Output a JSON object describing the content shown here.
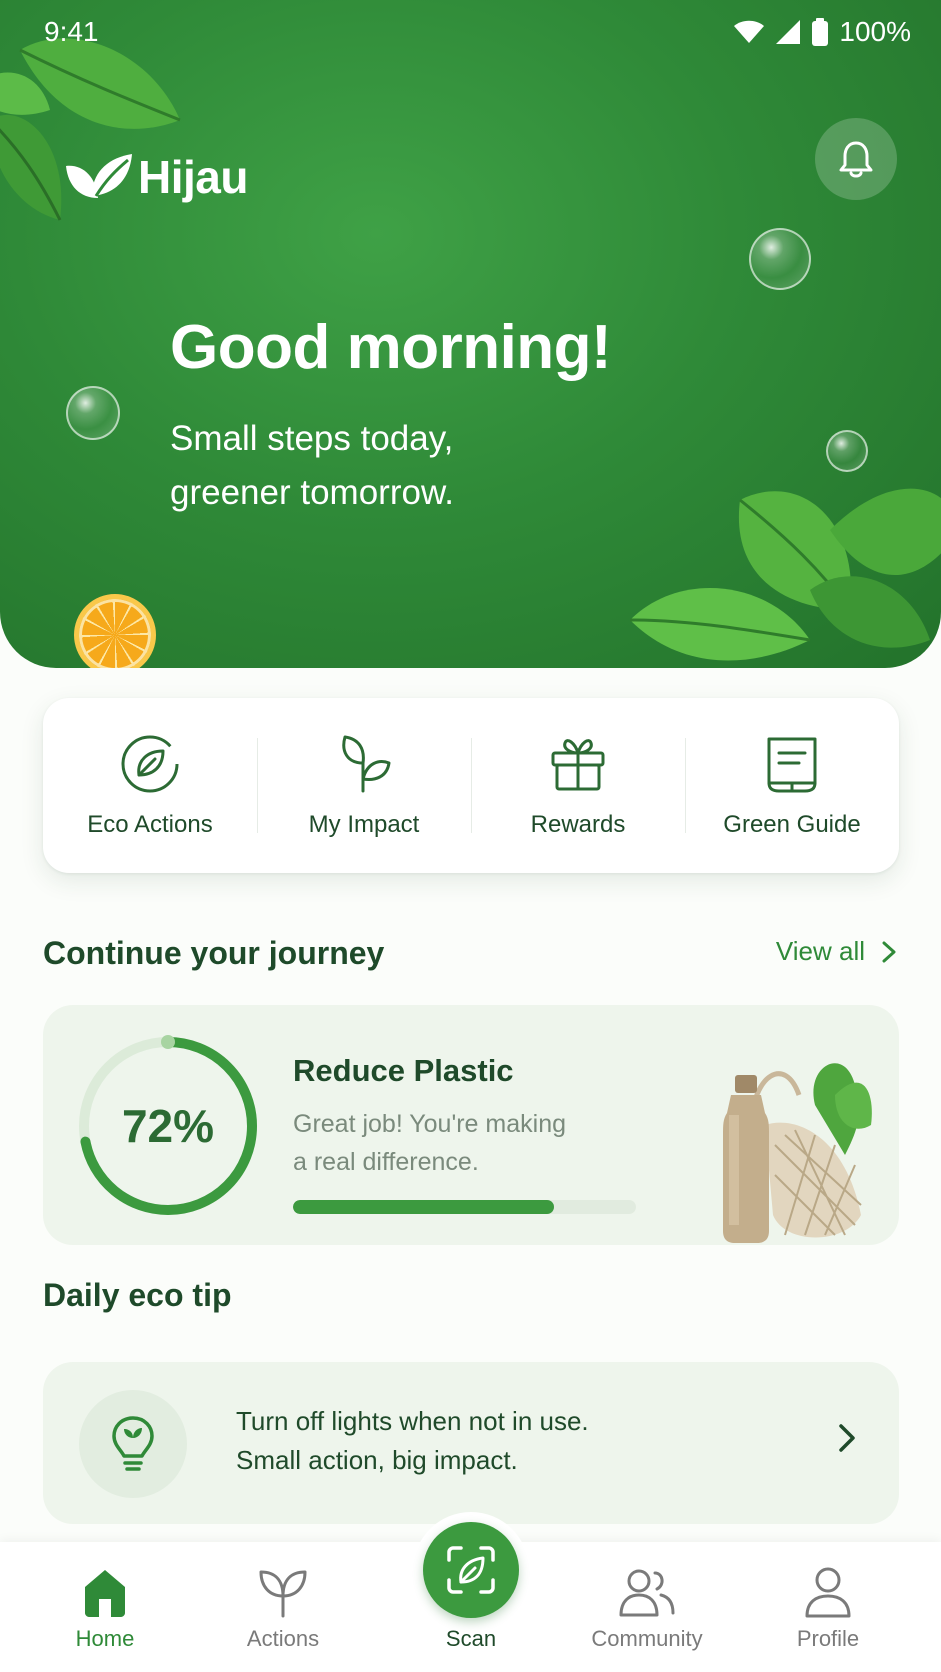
{
  "status_bar": {
    "time": "9:41",
    "battery": "100%"
  },
  "header": {
    "brand": "Hijau",
    "greeting": "Good morning!",
    "subtitle_line1": "Small steps today,",
    "subtitle_line2": "greener tomorrow."
  },
  "quick_actions": [
    {
      "label": "Eco Actions",
      "icon": "leaf-circle-icon"
    },
    {
      "label": "My Impact",
      "icon": "sprout-icon"
    },
    {
      "label": "Rewards",
      "icon": "gift-icon"
    },
    {
      "label": "Green Guide",
      "icon": "book-icon"
    }
  ],
  "journey": {
    "section_title": "Continue your journey",
    "view_all": "View all",
    "progress_text": "72%",
    "progress": 0.72,
    "bar_progress": 0.76,
    "title": "Reduce Plastic",
    "desc_line1": "Great job! You're making",
    "desc_line2": "a real difference."
  },
  "tip": {
    "section_title": "Daily eco tip",
    "line1": "Turn off lights when not in use.",
    "line2": "Small action, big impact."
  },
  "nav": [
    {
      "label": "Home",
      "icon": "home-icon",
      "active": true
    },
    {
      "label": "Actions",
      "icon": "sprout-icon",
      "active": false
    },
    {
      "label": "Scan",
      "icon": "scan-leaf-icon",
      "active": false
    },
    {
      "label": "Community",
      "icon": "community-icon",
      "active": false
    },
    {
      "label": "Profile",
      "icon": "profile-icon",
      "active": false
    }
  ],
  "colors": {
    "primary": "#2f8a38",
    "accent": "#3c9a3f",
    "text_dark": "#1f4a2a",
    "muted": "#7a8a7c",
    "card_bg": "#eef5ec"
  }
}
